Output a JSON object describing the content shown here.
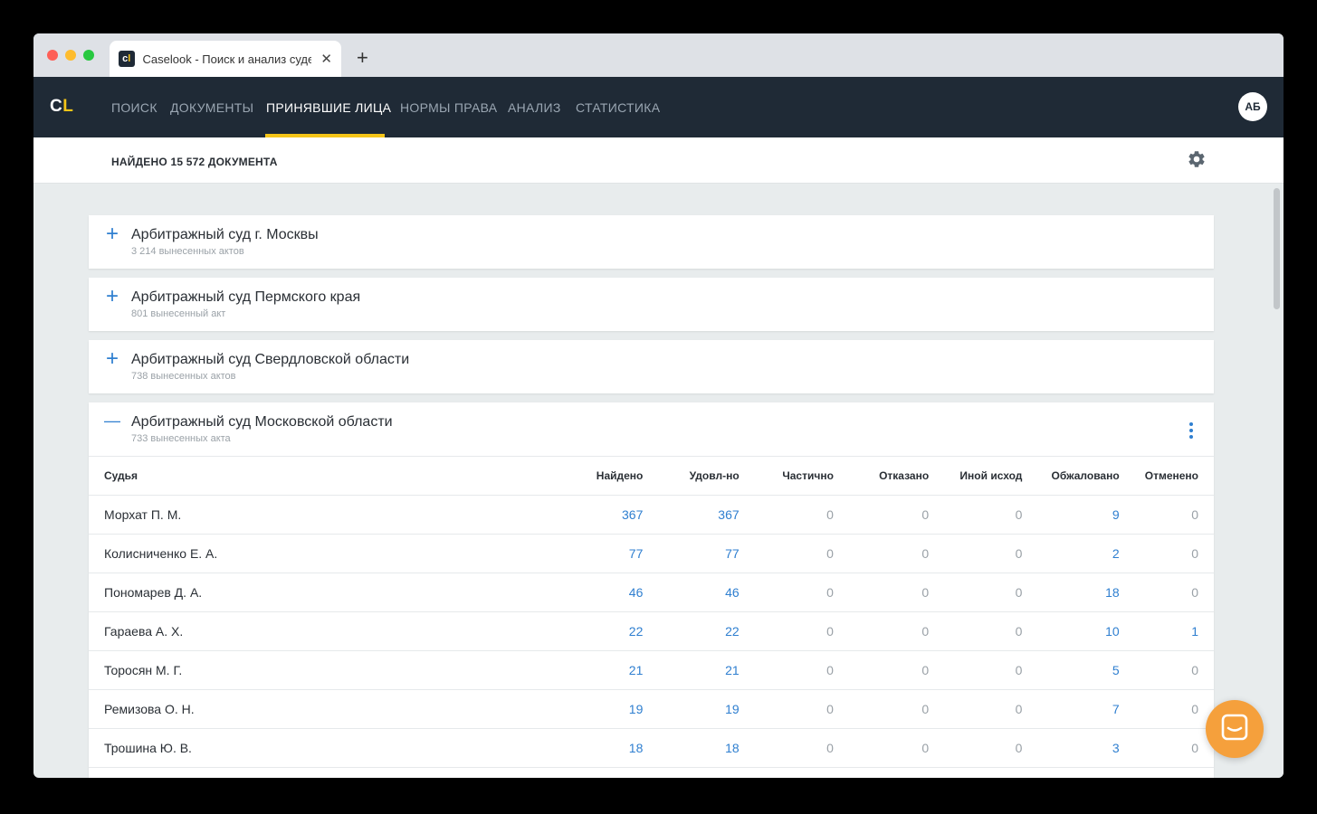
{
  "browser": {
    "tab_title": "Caselook - Поиск и анализ суде",
    "tab_favicon": "cl",
    "close_symbol": "✕",
    "new_tab_symbol": "+"
  },
  "nav": {
    "logo_c": "C",
    "logo_l": "L",
    "items": [
      "ПОИСК",
      "ДОКУМЕНТЫ",
      "ПРИНЯВШИЕ ЛИЦА",
      "НОРМЫ ПРАВА",
      "АНАЛИЗ",
      "СТАТИСТИКА"
    ],
    "active_index": 2,
    "avatar_initials": "АБ"
  },
  "subbar": {
    "found_text": "НАЙДЕНО 15 572 ДОКУМЕНТА"
  },
  "courts": [
    {
      "toggle": "+",
      "name": "Арбитражный суд г. Москвы",
      "sub": "3 214 вынесенных актов"
    },
    {
      "toggle": "+",
      "name": "Арбитражный суд Пермского края",
      "sub": "801 вынесенный акт"
    },
    {
      "toggle": "+",
      "name": "Арбитражный суд Свердловской области",
      "sub": "738 вынесенных актов"
    },
    {
      "toggle": "—",
      "name": "Арбитражный суд Московской области",
      "sub": "733 вынесенных акта"
    }
  ],
  "table": {
    "headers": [
      "Судья",
      "Найдено",
      "Удовл-но",
      "Частично",
      "Отказано",
      "Иной исход",
      "Обжаловано",
      "Отменено"
    ],
    "rows": [
      [
        "Морхат П. М.",
        "367",
        "367",
        "0",
        "0",
        "0",
        "9",
        "0"
      ],
      [
        "Колисниченко Е. А.",
        "77",
        "77",
        "0",
        "0",
        "0",
        "2",
        "0"
      ],
      [
        "Пономарев Д. А.",
        "46",
        "46",
        "0",
        "0",
        "0",
        "18",
        "0"
      ],
      [
        "Гараева А. Х.",
        "22",
        "22",
        "0",
        "0",
        "0",
        "10",
        "1"
      ],
      [
        "Торосян М. Г.",
        "21",
        "21",
        "0",
        "0",
        "0",
        "5",
        "0"
      ],
      [
        "Ремизова О. Н.",
        "19",
        "19",
        "0",
        "0",
        "0",
        "7",
        "0"
      ],
      [
        "Трошина Ю. В.",
        "18",
        "18",
        "0",
        "0",
        "0",
        "3",
        "0"
      ]
    ]
  },
  "colors": {
    "nav_bg": "#1f2a36",
    "accent_yellow": "#f5c518",
    "link_blue": "#2f7fd0",
    "chat_orange": "#f5a03c"
  }
}
